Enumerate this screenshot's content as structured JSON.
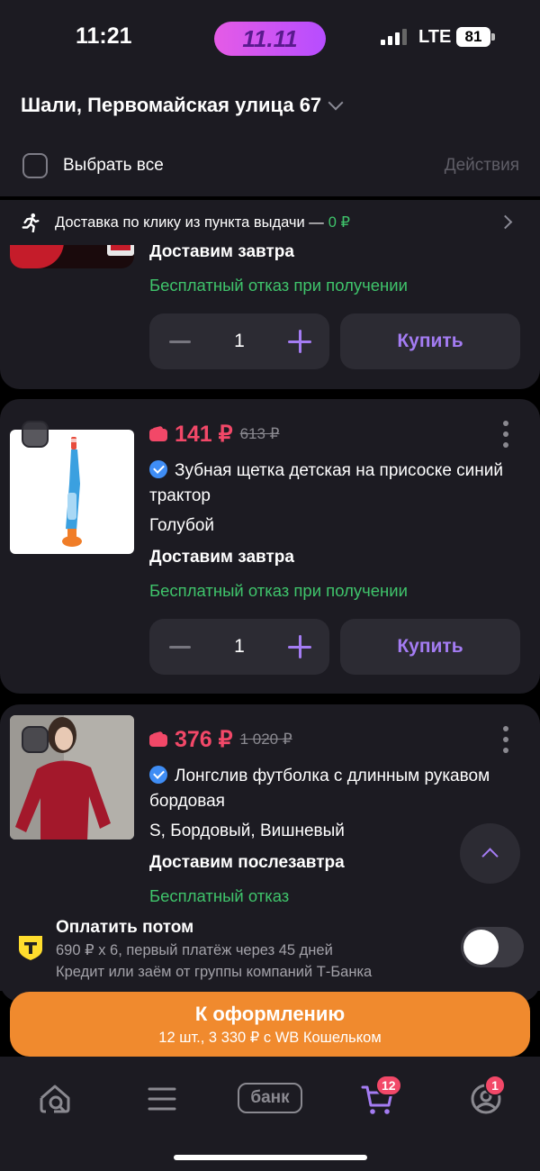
{
  "status_bar": {
    "time": "11:21",
    "promo": "11.11",
    "network": "LTE",
    "battery": "81"
  },
  "header": {
    "address": "Шали, Первомайская улица 67",
    "select_all": "Выбрать все",
    "actions": "Действия"
  },
  "delivery_banner": {
    "text": "Доставка по клику из пункта выдачи — ",
    "price": "0 ₽"
  },
  "items": [
    {
      "delivery": "Доставим завтра",
      "return_policy": "Бесплатный отказ при получении",
      "quantity": "1",
      "buy_label": "Купить"
    },
    {
      "price": "141 ₽",
      "old_price": "613 ₽",
      "title": "Зубная щетка детская на присоске синий трактор",
      "variant": "Голубой",
      "delivery": "Доставим завтра",
      "return_policy": "Бесплатный отказ при получении",
      "quantity": "1",
      "buy_label": "Купить"
    },
    {
      "price": "376 ₽",
      "old_price": "1 020 ₽",
      "title": "Лонгслив футболка с длинным рукавом бордовая",
      "variant": "S, Бордовый, Вишневый",
      "delivery": "Доставим послезавтра",
      "return_policy": "Бесплатный отказ"
    }
  ],
  "pay_later": {
    "title": "Оплатить потом",
    "schedule": "690 ₽ x 6, первый платёж через 45 дней",
    "credit_note": "Кредит или заём от группы компаний Т-Банка",
    "enabled": false
  },
  "checkout": {
    "label": "К оформлению",
    "summary": "12 шт., 3 330 ₽ с WB Кошельком"
  },
  "tabbar": {
    "bank_label": "банк",
    "cart_badge": "12",
    "profile_badge": "1"
  },
  "colors": {
    "price": "#f24868",
    "accent": "#a47cf3",
    "success": "#3fc46b",
    "checkout": "#f08a2e"
  },
  "icons": [
    "search-home-icon",
    "menu-icon",
    "bank-icon",
    "cart-icon",
    "profile-icon",
    "verified-icon",
    "wallet-icon",
    "running-person-icon"
  ]
}
